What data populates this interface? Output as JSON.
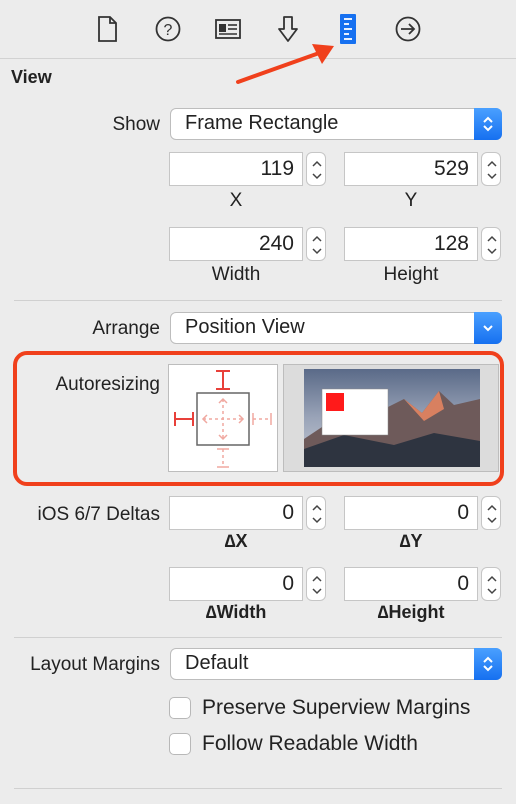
{
  "toolbar": {
    "icons": [
      "file-inspector-icon",
      "quick-help-icon",
      "identity-inspector-icon",
      "attributes-inspector-icon",
      "size-inspector-icon",
      "connections-inspector-icon"
    ]
  },
  "view": {
    "title": "View",
    "show_label": "Show",
    "show_value": "Frame Rectangle",
    "x_value": "119",
    "y_value": "529",
    "width_value": "240",
    "height_value": "128",
    "x_label": "X",
    "y_label": "Y",
    "width_label": "Width",
    "height_label": "Height",
    "arrange_label": "Arrange",
    "arrange_value": "Position View",
    "autoresizing_label": "Autoresizing",
    "ios_deltas_label": "iOS 6/7 Deltas",
    "dx_value": "0",
    "dy_value": "0",
    "dwidth_value": "0",
    "dheight_value": "0",
    "dx_label": "∆X",
    "dy_label": "∆Y",
    "dwidth_label": "∆Width",
    "dheight_label": "∆Height",
    "layout_margins_label": "Layout Margins",
    "layout_margins_value": "Default",
    "preserve_label": "Preserve Superview Margins",
    "follow_label": "Follow Readable Width"
  },
  "colors": {
    "accent": "#1670f0",
    "highlight": "#f0401c",
    "autoresize": "#e8403a"
  }
}
